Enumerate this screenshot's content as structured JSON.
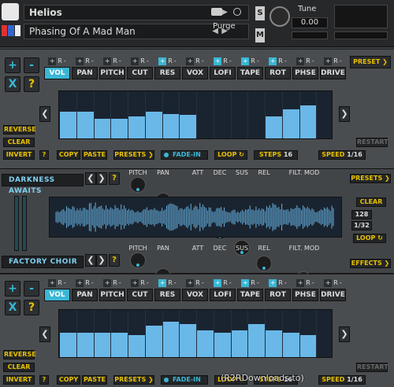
{
  "header": {
    "instrument_name": "Helios",
    "preset_name": "Phasing Of A Mad Man",
    "prev_label": "◀",
    "next_label": "▶",
    "purge_label": "Purge",
    "solo_label": "S",
    "mute_label": "M",
    "tune_label": "Tune",
    "tune_value": "0.00",
    "close_label": "✕",
    "info_label": "ⓘ"
  },
  "top": {
    "add_label": "+",
    "sub_label": "-",
    "x_label": "X",
    "q_label": "?",
    "fx_top_plus": "+",
    "fx_top_r": "R",
    "fx_top_minus": "-",
    "fx": [
      {
        "label": "VOL",
        "on": true,
        "plus_on": false
      },
      {
        "label": "PAN",
        "on": false,
        "plus_on": false
      },
      {
        "label": "PITCH",
        "on": false,
        "plus_on": false
      },
      {
        "label": "CUT",
        "on": false,
        "plus_on": false
      },
      {
        "label": "RES",
        "on": false,
        "plus_on": true
      },
      {
        "label": "VOX",
        "on": false,
        "plus_on": false
      },
      {
        "label": "LOFI",
        "on": false,
        "plus_on": true
      },
      {
        "label": "TAPE",
        "on": false,
        "plus_on": true
      },
      {
        "label": "ROT",
        "on": false,
        "plus_on": true
      },
      {
        "label": "PHSE",
        "on": false,
        "plus_on": false
      },
      {
        "label": "DRIVE",
        "on": false,
        "plus_on": false
      }
    ],
    "preset_label": "PRESET ❯",
    "seq_values": [
      0.55,
      0.55,
      0.4,
      0.4,
      0.45,
      0.55,
      0.5,
      0.48,
      0,
      0,
      0,
      0,
      0.45,
      0.6,
      0.68,
      0
    ],
    "reverse_label": "REVERSE",
    "clear_label": "CLEAR",
    "invert_label": "INVERT",
    "q2_label": "?",
    "copy_label": "COPY",
    "paste_label": "PASTE",
    "presets_label": "PRESETS ❯",
    "fade_label": "FADE-IN",
    "loop_label": "LOOP ↻",
    "steps_label": "STEPS",
    "steps_value": "16",
    "speed_label": "SPEED",
    "speed_value": "1/16",
    "restart_label": "RESTART",
    "left_arrow": "❮",
    "right_arrow": "❯"
  },
  "mid": {
    "layer1_name": "DARKNESS AWAITS",
    "layer2_name": "FACTORY CHOIR",
    "q_label": "?",
    "left_arrow": "❮",
    "right_arrow": "❯",
    "knob_labels": [
      "PITCH",
      "PAN",
      "ATT",
      "DEC",
      "SUS",
      "REL",
      "FILT. MOD"
    ],
    "presets_label": "PRESETS ❯",
    "clear_label": "CLEAR",
    "rate_value": "128",
    "div_value": "1/32",
    "loop_label": "LOOP ↻",
    "effects_label": "EFFECTS ❯"
  },
  "bottom": {
    "seq_values": [
      0.5,
      0.5,
      0.5,
      0.5,
      0.45,
      0.65,
      0.72,
      0.68,
      0.55,
      0.5,
      0.55,
      0.68,
      0.55,
      0.5,
      0.45,
      0
    ],
    "reverse_label": "REVERSE",
    "clear_label": "CLEAR",
    "invert_label": "INVERT",
    "q2_label": "?",
    "copy_label": "COPY",
    "paste_label": "PASTE",
    "presets_label": "PRESETS ❯",
    "fade_label": "FADE-IN",
    "loop_label": "LOOP ↻",
    "steps_label": "STEPS",
    "steps_value": "16",
    "speed_label": "SPEED",
    "speed_value": "1/16",
    "restart_label": "RESTART"
  },
  "watermark": "(R2RDownloads.to)",
  "colors": {
    "accent": "#39b7d5",
    "yellow": "#e8c000",
    "bar": "#6ab8e8"
  }
}
